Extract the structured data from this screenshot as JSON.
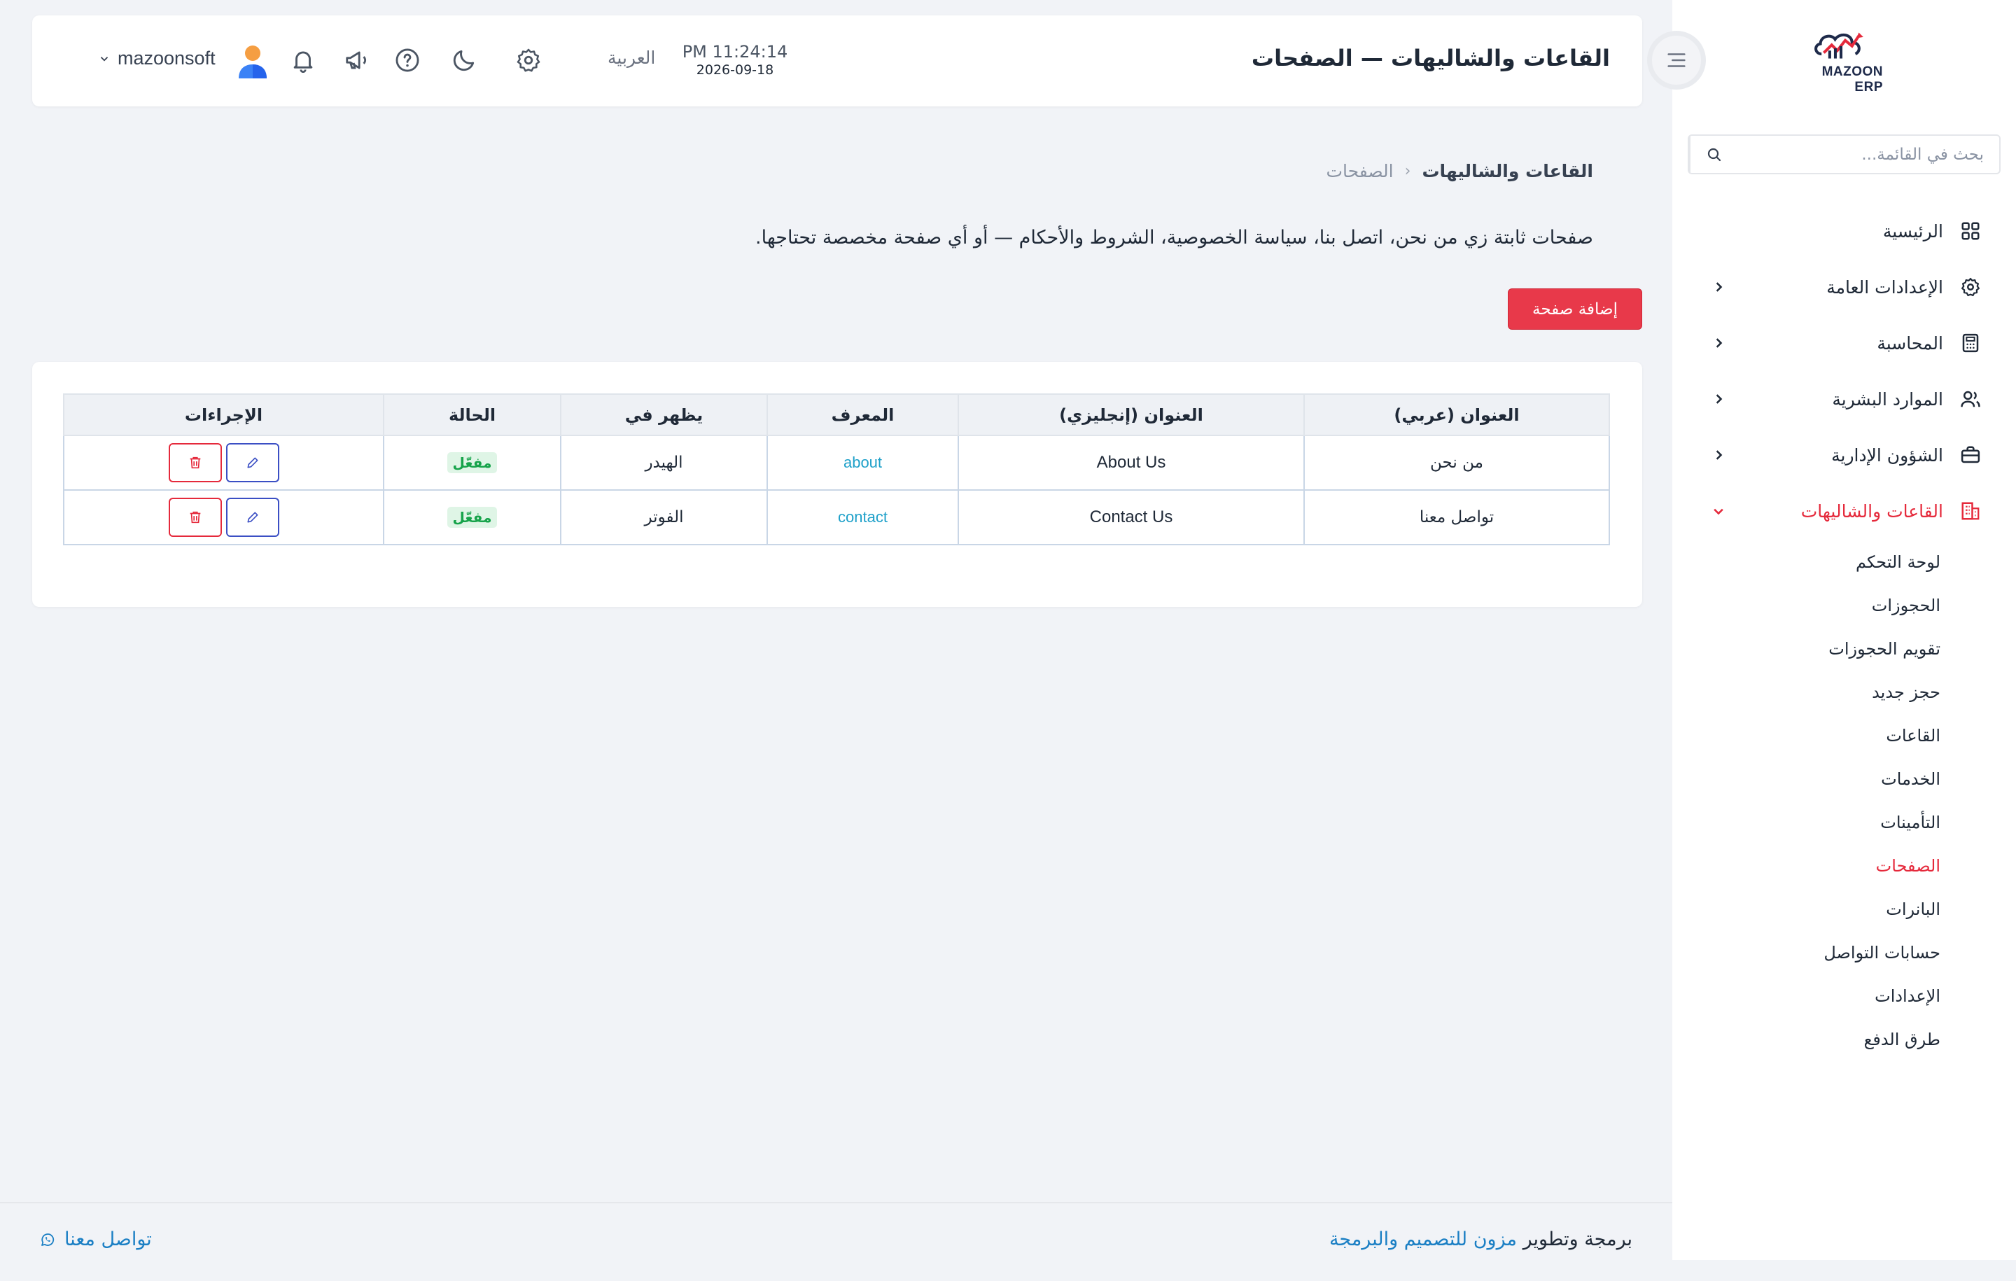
{
  "brand": {
    "logo_text": "MAZOON ERP",
    "logo_small_text": "ERP"
  },
  "sidebar": {
    "search_placeholder": "بحث في القائمة...",
    "items": [
      {
        "label": "الرئيسية",
        "icon": "grid-icon"
      },
      {
        "label": "الإعدادات العامة",
        "icon": "gear-icon"
      },
      {
        "label": "المحاسبة",
        "icon": "calculator-icon"
      },
      {
        "label": "الموارد البشرية",
        "icon": "users-icon"
      },
      {
        "label": "الشؤون الإدارية",
        "icon": "briefcase-icon"
      },
      {
        "label": "القاعات والشاليهات",
        "icon": "building-icon"
      }
    ],
    "sub_items": [
      {
        "label": "لوحة التحكم"
      },
      {
        "label": "الحجوزات"
      },
      {
        "label": "تقويم الحجوزات"
      },
      {
        "label": "حجز جديد"
      },
      {
        "label": "القاعات"
      },
      {
        "label": "الخدمات"
      },
      {
        "label": "التأمينات"
      },
      {
        "label": "الصفحات"
      },
      {
        "label": "البانرات"
      },
      {
        "label": "حسابات التواصل"
      },
      {
        "label": "الإعدادات"
      },
      {
        "label": "طرق الدفع"
      }
    ]
  },
  "header": {
    "title": "القاعات والشاليهات — الصفحات",
    "time": "PM 11:24:14",
    "date": "2026-09-18",
    "language": "العربية",
    "username": "mazoonsoft"
  },
  "breadcrumb": {
    "parent": "القاعات والشاليهات",
    "current": "الصفحات"
  },
  "description": "صفحات ثابتة زي من نحن، اتصل بنا، سياسة الخصوصية، الشروط والأحكام — أو أي صفحة مخصصة تحتاجها.",
  "add_button": "إضافة صفحة",
  "table": {
    "headers": {
      "title_ar": "العنوان (عربي)",
      "title_en": "العنوان (إنجليزي)",
      "slug": "المعرف",
      "location": "يظهر في",
      "status": "الحالة",
      "actions": "الإجراءات"
    },
    "rows": [
      {
        "title_ar": "من نحن",
        "title_en": "About Us",
        "slug": "about",
        "location": "الهيدر",
        "status": "مفعّل"
      },
      {
        "title_ar": "تواصل معنا",
        "title_en": "Contact Us",
        "slug": "contact",
        "location": "الفوتر",
        "status": "مفعّل"
      }
    ]
  },
  "footer": {
    "credit_prefix": "برمجة وتطوير",
    "credit_link": "مزون للتصميم والبرمجة",
    "contact": "تواصل معنا"
  },
  "colors": {
    "accent": "#e8394a",
    "link": "#1b7fc4",
    "slug": "#1ea0c9",
    "success": "#16a34a",
    "edit": "#3b4fc4"
  }
}
